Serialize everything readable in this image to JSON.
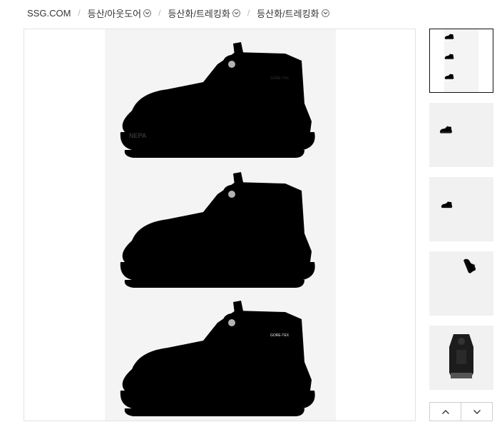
{
  "breadcrumb": {
    "home": "SSG.COM",
    "items": [
      {
        "label": "등산/아웃도어",
        "icon": "chevron-down-circle-icon"
      },
      {
        "label": "등산화/트레킹화",
        "icon": "chevron-down-circle-icon"
      },
      {
        "label": "등산화/트레킹화",
        "icon": "chevron-down-circle-icon"
      }
    ]
  },
  "main_image": {
    "logo_text": "NEPA",
    "badge_text": "GORE-TEX",
    "shoe_colors": [
      "#d8d2c8",
      "#1c1c1c",
      "#5b4636"
    ]
  },
  "thumbnails": [
    {
      "content": "three-shoes",
      "selected": true
    },
    {
      "content": "brown-shoe",
      "selected": false
    },
    {
      "content": "black-shoe",
      "selected": false
    },
    {
      "content": "black-shoe-top",
      "selected": false
    },
    {
      "content": "black-shoe-back",
      "selected": false
    }
  ],
  "pager": {
    "prev_icon": "chevron-up-icon",
    "next_icon": "chevron-down-icon"
  }
}
